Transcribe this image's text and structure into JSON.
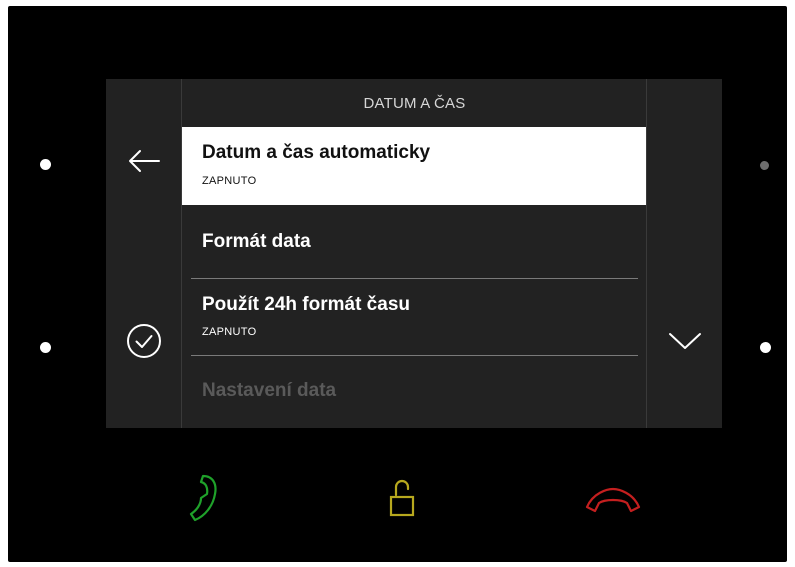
{
  "screen": {
    "title": "DATUM A ČAS",
    "items": [
      {
        "label": "Datum a čas automaticky",
        "value": "ZAPNUTO",
        "selected": true
      },
      {
        "label": "Formát data",
        "value": ""
      },
      {
        "label": "Použít 24h formát času",
        "value": "ZAPNUTO"
      },
      {
        "label": "Nastavení data",
        "value": "",
        "disabled": true
      }
    ],
    "icons": {
      "back": "arrow-left-icon",
      "confirm": "check-circle-icon",
      "scroll": "chevron-down-icon"
    }
  },
  "hardware_buttons": {
    "answer": {
      "icon": "phone-answer-icon",
      "color": "#1fa12a"
    },
    "unlock": {
      "icon": "unlock-icon",
      "color": "#b7a81e"
    },
    "hangup": {
      "icon": "phone-hangup-icon",
      "color": "#c41f1f"
    }
  },
  "colors": {
    "screen_bg": "#222222",
    "selected_bg": "#ffffff",
    "device_bg": "#000000"
  }
}
